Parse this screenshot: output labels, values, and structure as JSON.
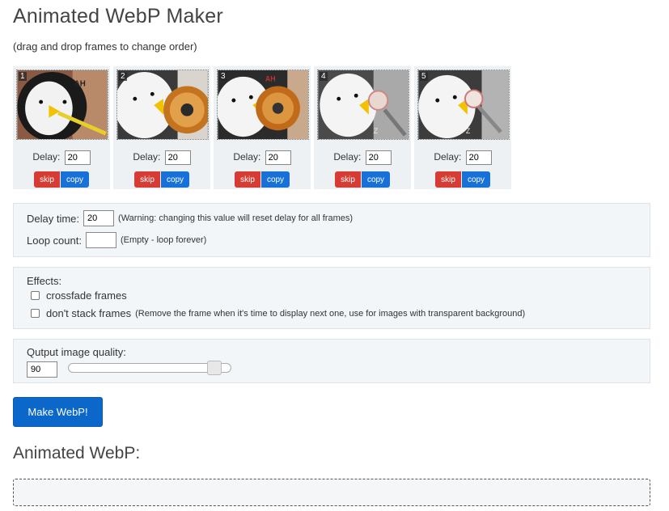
{
  "title": "Animated WebP Maker",
  "hint": "(drag and drop frames to change order)",
  "frames": [
    {
      "num": "1",
      "delay_label": "Delay:",
      "delay": "20",
      "skip": "skip",
      "copy": "copy"
    },
    {
      "num": "2",
      "delay_label": "Delay:",
      "delay": "20",
      "skip": "skip",
      "copy": "copy"
    },
    {
      "num": "3",
      "delay_label": "Delay:",
      "delay": "20",
      "skip": "skip",
      "copy": "copy"
    },
    {
      "num": "4",
      "delay_label": "Delay:",
      "delay": "20",
      "skip": "skip",
      "copy": "copy"
    },
    {
      "num": "5",
      "delay_label": "Delay:",
      "delay": "20",
      "skip": "skip",
      "copy": "copy"
    }
  ],
  "settings": {
    "delay_label": "Delay time:",
    "delay_value": "20",
    "delay_note": "(Warning: changing this value will reset delay for all frames)",
    "loop_label": "Loop count:",
    "loop_value": "",
    "loop_note": "(Empty - loop forever)"
  },
  "effects": {
    "label": "Effects:",
    "crossfade": "crossfade frames",
    "nostack": "don't stack frames",
    "nostack_note": "(Remove the frame when it's time to display next one, use for images with transparent background)"
  },
  "quality": {
    "label": "Qutput image quality:",
    "value": "90",
    "slider_fraction": 0.9
  },
  "make_button": "Make WebP!",
  "result_title": "Animated WebP:",
  "colors": {
    "skip": "#d63b34",
    "copy": "#1771d9",
    "primary": "#0b67c9",
    "panel": "#f3f6f8"
  }
}
